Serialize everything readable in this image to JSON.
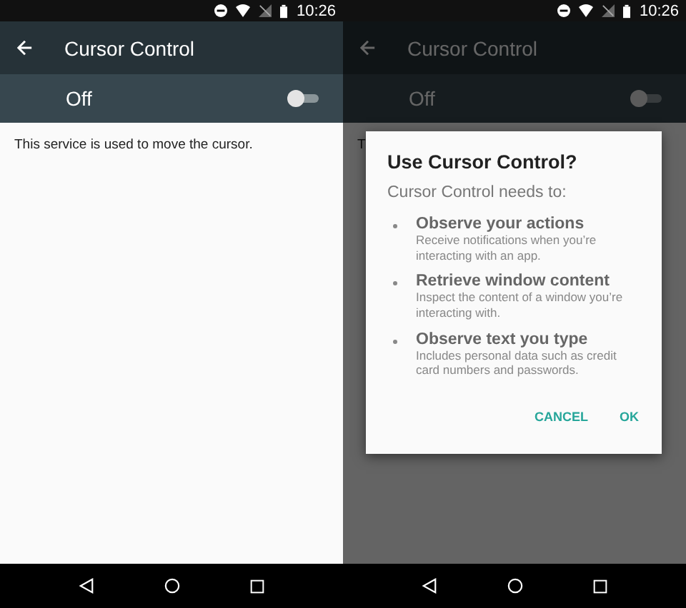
{
  "screens": [
    {
      "status_bar": {
        "time": "10:26"
      },
      "toolbar": {
        "title": "Cursor Control"
      },
      "switch_bar": {
        "label": "Off",
        "on": false
      },
      "description": "This service is used to move the cursor.",
      "dimmed": false
    },
    {
      "status_bar": {
        "time": "10:26"
      },
      "toolbar": {
        "title": "Cursor Control"
      },
      "switch_bar": {
        "label": "Off",
        "on": false
      },
      "description": "T",
      "dimmed": true,
      "dialog": {
        "title": "Use Cursor Control?",
        "intro": "Cursor Control needs to:",
        "items": [
          {
            "title": "Observe your actions",
            "detail": "Receive notifications when you’re interacting with an app."
          },
          {
            "title": "Retrieve window content",
            "detail": "Inspect the content of a window you’re interacting with."
          },
          {
            "title": "Observe text you type",
            "detail": "Includes personal data such as credit card numbers and passwords."
          }
        ],
        "buttons": [
          "CANCEL",
          "OK"
        ]
      }
    }
  ]
}
